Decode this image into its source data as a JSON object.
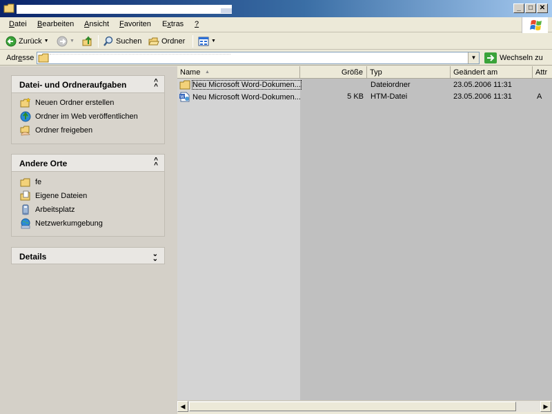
{
  "menu": {
    "items": [
      {
        "pre": "",
        "u": "D",
        "post": "atei"
      },
      {
        "pre": "",
        "u": "B",
        "post": "earbeiten"
      },
      {
        "pre": "",
        "u": "A",
        "post": "nsicht"
      },
      {
        "pre": "",
        "u": "F",
        "post": "avoriten"
      },
      {
        "pre": "E",
        "u": "x",
        "post": "tras"
      },
      {
        "pre": "",
        "u": "?",
        "post": ""
      }
    ]
  },
  "toolbar": {
    "back_label": "Zurück",
    "search_label": "Suchen",
    "folders_label": "Ordner"
  },
  "address": {
    "label_pre": "Adr",
    "label_u": "e",
    "label_post": "sse",
    "go_label": "Wechseln zu"
  },
  "taskpane": {
    "file_tasks": {
      "title": "Datei- und Ordneraufgaben",
      "items": [
        "Neuen Ordner erstellen",
        "Ordner im Web veröffentlichen",
        "Ordner freigeben"
      ]
    },
    "other_places": {
      "title": "Andere Orte",
      "items": [
        "fe",
        "Eigene Dateien",
        "Arbeitsplatz",
        "Netzwerkumgebung"
      ]
    },
    "details": {
      "title": "Details"
    }
  },
  "list": {
    "columns": [
      "Name",
      "Größe",
      "Typ",
      "Geändert am",
      "Attr"
    ],
    "rows": [
      {
        "name": "Neu Microsoft Word-Dokumen...",
        "size": "",
        "type": "Dateiordner",
        "modified": "23.05.2006 11:31",
        "attr": "",
        "icon": "folder-icon"
      },
      {
        "name": "Neu Microsoft Word-Dokumen...",
        "size": "5 KB",
        "type": "HTM-Datei",
        "modified": "23.05.2006 11:31",
        "attr": "A",
        "icon": "word-html-file-icon"
      }
    ]
  },
  "colors": {
    "title_start": "#0a246a",
    "title_end": "#a6caf0",
    "window_bg": "#ece9d8",
    "list_bg": "#c0c0c0",
    "taskpane_bg": "#d4d0c8"
  }
}
